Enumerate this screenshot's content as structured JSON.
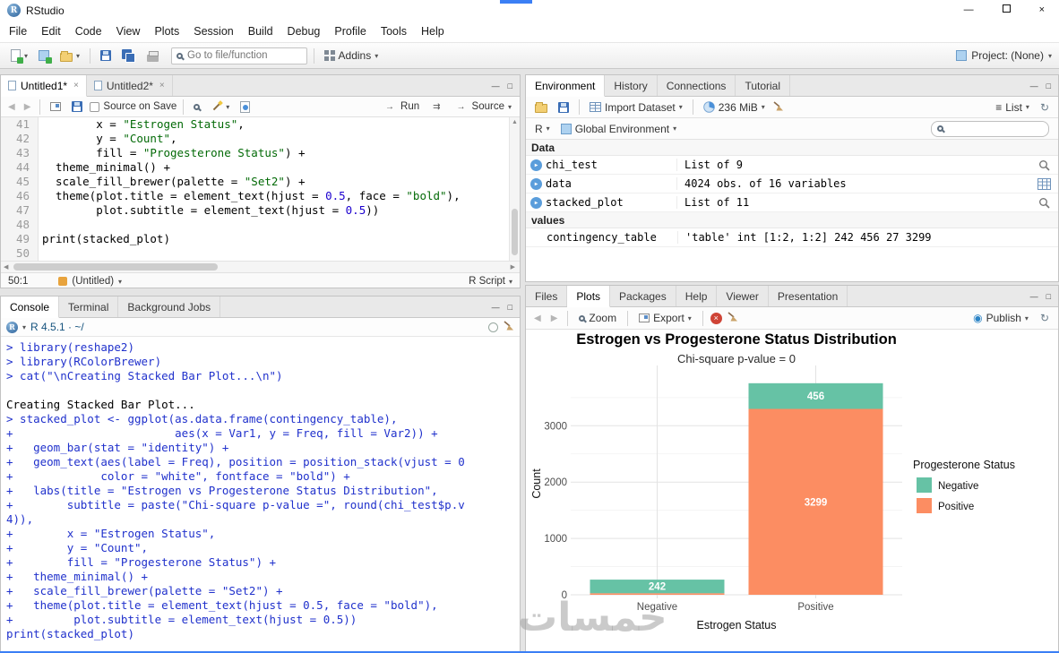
{
  "icons": {
    "caret_down": "▾",
    "back_arrow": "◀",
    "forward_arrow": "▶",
    "up_arrow": "▲",
    "run_arrow": "→",
    "rerun_arrows": "⇉",
    "refresh": "↻",
    "list_menu": "≡",
    "close": "×",
    "close_small": "×",
    "minimize": "—",
    "maximize": "□",
    "publish_dot": "◉",
    "r_letter": "R"
  },
  "titlebar": {
    "app_name": "RStudio",
    "logo_letter": "R"
  },
  "menu": [
    "File",
    "Edit",
    "Code",
    "View",
    "Plots",
    "Session",
    "Build",
    "Debug",
    "Profile",
    "Tools",
    "Help"
  ],
  "main_toolbar": {
    "goto_placeholder": "Go to file/function",
    "addins": "Addins",
    "project": "Project: (None)"
  },
  "source": {
    "tabs": [
      "Untitled1*",
      "Untitled2*"
    ],
    "active_tab": 0,
    "source_on_save": "Source on Save",
    "run": "Run",
    "source_btn": "Source",
    "lines": [
      {
        "n": 41,
        "t": "        x = \"Estrogen Status\","
      },
      {
        "n": 42,
        "t": "        y = \"Count\","
      },
      {
        "n": 43,
        "t": "        fill = \"Progesterone Status\") +"
      },
      {
        "n": 44,
        "t": "  theme_minimal() +"
      },
      {
        "n": 45,
        "t": "  scale_fill_brewer(palette = \"Set2\") +"
      },
      {
        "n": 46,
        "t": "  theme(plot.title = element_text(hjust = 0.5, face = \"bold\"),"
      },
      {
        "n": 47,
        "t": "        plot.subtitle = element_text(hjust = 0.5))"
      },
      {
        "n": 48,
        "t": ""
      },
      {
        "n": 49,
        "t": "print(stacked_plot)"
      },
      {
        "n": 50,
        "t": ""
      }
    ],
    "status": {
      "cursor": "50:1",
      "doc": "(Untitled)",
      "filetype": "R Script"
    }
  },
  "console": {
    "tabs": [
      "Console",
      "Terminal",
      "Background Jobs"
    ],
    "header": "R 4.5.1 · ~/",
    "lines": [
      {
        "k": "in",
        "t": "> library(reshape2)"
      },
      {
        "k": "in",
        "t": "> library(RColorBrewer)"
      },
      {
        "k": "in",
        "t": "> cat(\"\\nCreating Stacked Bar Plot...\\n\")"
      },
      {
        "k": "out",
        "t": ""
      },
      {
        "k": "out",
        "t": "Creating Stacked Bar Plot..."
      },
      {
        "k": "in",
        "t": "> stacked_plot <- ggplot(as.data.frame(contingency_table),"
      },
      {
        "k": "in",
        "t": "+                        aes(x = Var1, y = Freq, fill = Var2)) +"
      },
      {
        "k": "in",
        "t": "+   geom_bar(stat = \"identity\") +"
      },
      {
        "k": "in",
        "t": "+   geom_text(aes(label = Freq), position = position_stack(vjust = 0"
      },
      {
        "k": "in",
        "t": "+             color = \"white\", fontface = \"bold\") +"
      },
      {
        "k": "in",
        "t": "+   labs(title = \"Estrogen vs Progesterone Status Distribution\","
      },
      {
        "k": "in",
        "t": "+        subtitle = paste(\"Chi-square p-value =\", round(chi_test$p.v"
      },
      {
        "k": "in",
        "t": "4)),"
      },
      {
        "k": "in",
        "t": "+        x = \"Estrogen Status\","
      },
      {
        "k": "in",
        "t": "+        y = \"Count\","
      },
      {
        "k": "in",
        "t": "+        fill = \"Progesterone Status\") +"
      },
      {
        "k": "in",
        "t": "+   theme_minimal() +"
      },
      {
        "k": "in",
        "t": "+   scale_fill_brewer(palette = \"Set2\") +"
      },
      {
        "k": "in",
        "t": "+   theme(plot.title = element_text(hjust = 0.5, face = \"bold\"),"
      },
      {
        "k": "in",
        "t": "+         plot.subtitle = element_text(hjust = 0.5))"
      },
      {
        "k": "in",
        "t": "print(stacked_plot)"
      }
    ]
  },
  "environment": {
    "tabs": [
      "Environment",
      "History",
      "Connections",
      "Tutorial"
    ],
    "toolbar": {
      "import": "Import Dataset",
      "memory": "236 MiB",
      "list": "List"
    },
    "r_selector": "R",
    "scope": "Global Environment",
    "sections": [
      {
        "header": "Data",
        "rows": [
          {
            "name": "chi_test",
            "value": "List of 9",
            "expand": true,
            "action": "magnifier"
          },
          {
            "name": "data",
            "value": "4024 obs. of 16 variables",
            "expand": true,
            "action": "grid"
          },
          {
            "name": "stacked_plot",
            "value": "List of 11",
            "expand": true,
            "action": "magnifier"
          }
        ]
      },
      {
        "header": "values",
        "rows": [
          {
            "name": "contingency_table",
            "value": "'table' int [1:2, 1:2] 242 456 27 3299",
            "expand": false,
            "action": ""
          }
        ]
      }
    ]
  },
  "plots": {
    "tabs": [
      "Files",
      "Plots",
      "Packages",
      "Help",
      "Viewer",
      "Presentation"
    ],
    "active_tab": 1,
    "toolbar": {
      "zoom": "Zoom",
      "export": "Export",
      "publish": "Publish"
    }
  },
  "chart_data": {
    "type": "bar",
    "stacked": true,
    "title": "Estrogen vs Progesterone Status Distribution",
    "subtitle": "Chi-square p-value = 0",
    "xlabel": "Estrogen Status",
    "ylabel": "Count",
    "categories": [
      "Negative",
      "Positive"
    ],
    "legend_title": "Progesterone Status",
    "legend_position": "right",
    "series": [
      {
        "name": "Positive",
        "color": "#FC8D62",
        "values": [
          27,
          3299
        ]
      },
      {
        "name": "Negative",
        "color": "#66C2A5",
        "values": [
          242,
          456
        ]
      }
    ],
    "stack_note": "series listed bottom-to-top per bar",
    "legend_order": [
      "Negative",
      "Positive"
    ],
    "yticks": [
      0,
      1000,
      2000,
      3000
    ],
    "ylim": [
      0,
      3943
    ],
    "grid": true,
    "totals": {
      "Negative": 269,
      "Positive": 3755
    },
    "bar_label_color": "#ffffff"
  },
  "watermark": "خمسات"
}
